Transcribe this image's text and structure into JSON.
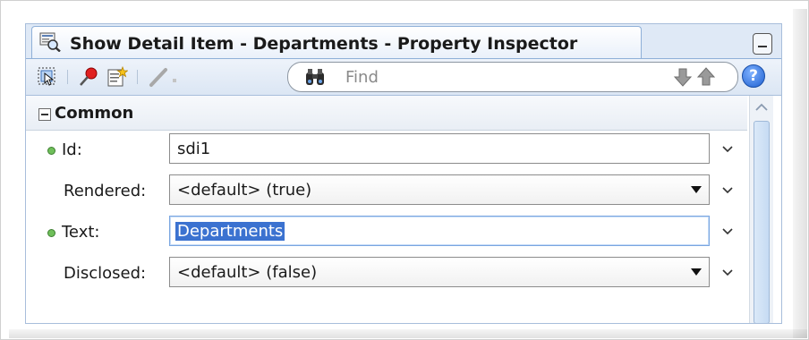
{
  "window": {
    "title": "Show Detail Item - Departments - Property Inspector"
  },
  "toolbar": {
    "find_placeholder": "Find",
    "help_label": "?"
  },
  "section": {
    "title": "Common"
  },
  "properties": [
    {
      "label": "Id:",
      "value": "sdi1",
      "type": "text",
      "required_marker": true
    },
    {
      "label": "Rendered:",
      "value": "<default> (true)",
      "type": "select",
      "required_marker": false
    },
    {
      "label": "Text:",
      "value": "Departments",
      "type": "text",
      "required_marker": true,
      "selected": true
    },
    {
      "label": "Disclosed:",
      "value": "<default> (false)",
      "type": "select",
      "required_marker": false
    }
  ],
  "colors": {
    "panel_bg": "#dfe9f6",
    "selection": "#3b72d0",
    "marker_dot": "#6fbf5a"
  }
}
